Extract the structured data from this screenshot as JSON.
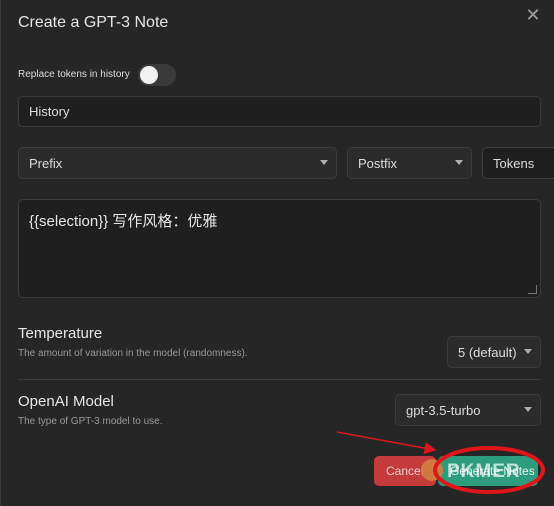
{
  "modal": {
    "title": "Create a GPT-3 Note",
    "close_icon": "close-icon"
  },
  "toggle": {
    "label": "Replace tokens in history",
    "on": false
  },
  "history": {
    "value": "History"
  },
  "prefix": {
    "value": "Prefix"
  },
  "postfix": {
    "value": "Postfix"
  },
  "tokens": {
    "value": "Tokens"
  },
  "prompt": {
    "value": "{{selection}} 写作风格：优雅"
  },
  "temperature": {
    "name": "Temperature",
    "desc": "The amount of variation in the model (randomness).",
    "value": "5 (default)"
  },
  "model": {
    "name": "OpenAI Model",
    "desc": "The type of GPT-3 model to use.",
    "value": "gpt-3.5-turbo"
  },
  "buttons": {
    "cancel": "Cancel",
    "generate": "Generate Notes"
  },
  "watermark": {
    "text": "PKMER"
  },
  "colors": {
    "background": "#262626",
    "cancel": "#c53a3a",
    "generate": "#2d9c7d",
    "annotation": "#e0161b"
  }
}
